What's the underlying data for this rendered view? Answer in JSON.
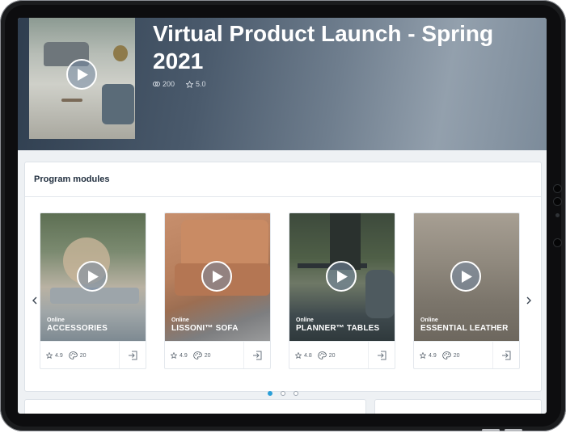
{
  "hero": {
    "title": "Virtual Product Launch - Spring 2021",
    "participants": "200",
    "rating": "5.0"
  },
  "modules": {
    "heading": "Program modules",
    "cards": [
      {
        "status": "Online",
        "name": "ACCESSORIES",
        "rating": "4.9",
        "count": "20"
      },
      {
        "status": "Online",
        "name": "LISSONI™ SOFA",
        "rating": "4.9",
        "count": "20"
      },
      {
        "status": "Online",
        "name": "PLANNER™ TABLES",
        "rating": "4.8",
        "count": "20"
      },
      {
        "status": "Online",
        "name": "ESSENTIAL LEATHER",
        "rating": "4.9",
        "count": "20"
      }
    ],
    "pagination": {
      "pages": 3,
      "active": 1
    }
  },
  "icons": {
    "play": "play-icon",
    "participants": "link-icon",
    "rating": "star-icon",
    "count": "palette-icon",
    "enter": "enter-icon",
    "prev": "chevron-left-icon",
    "next": "chevron-right-icon"
  },
  "colors": {
    "accent": "#2b9fd8",
    "title": "#1f2d3d"
  }
}
